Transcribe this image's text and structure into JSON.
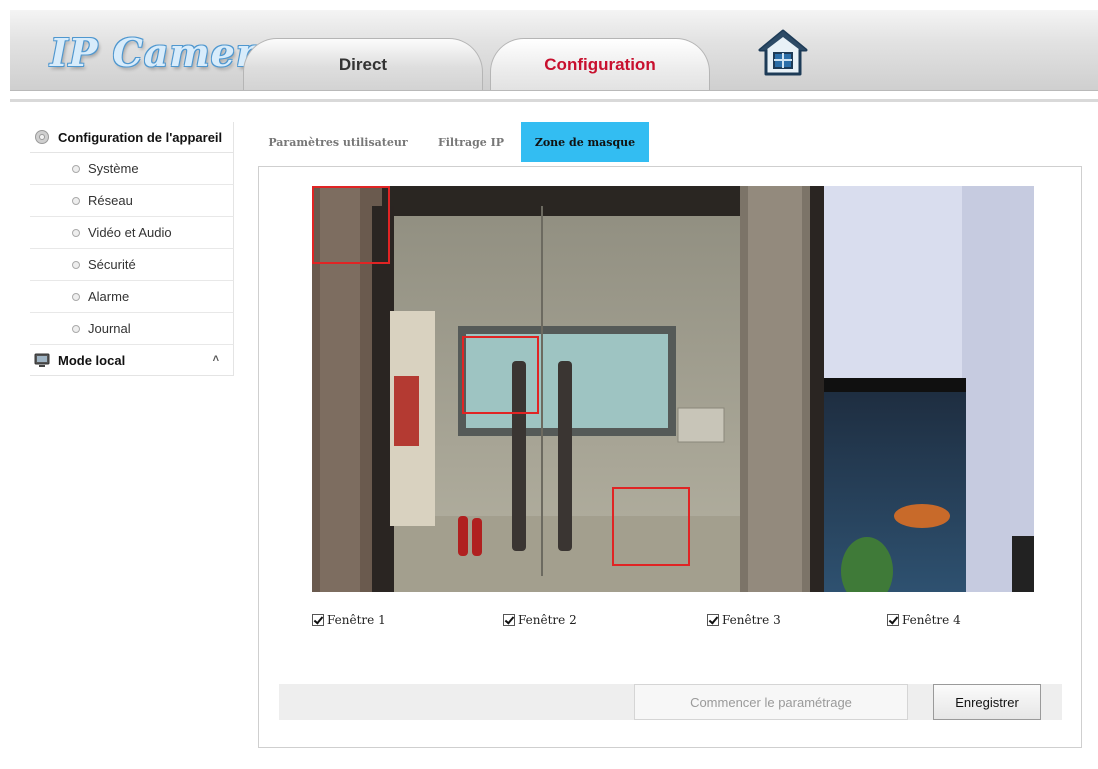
{
  "header": {
    "logo": "IP Camera",
    "tabs": [
      {
        "label": "Direct",
        "active": false
      },
      {
        "label": "Configuration",
        "active": true
      }
    ],
    "home_icon": "home-icon"
  },
  "sidebar": {
    "device_config": {
      "label": "Configuration de l'appareil",
      "icon": "gear-icon"
    },
    "items": [
      {
        "label": "Système"
      },
      {
        "label": "Réseau"
      },
      {
        "label": "Vidéo et Audio"
      },
      {
        "label": "Sécurité"
      },
      {
        "label": "Alarme"
      },
      {
        "label": "Journal"
      }
    ],
    "local_mode": {
      "label": "Mode local",
      "icon": "monitor-icon",
      "caret": "˄"
    }
  },
  "subtabs": [
    {
      "label": "Paramètres utilisateur",
      "active": false
    },
    {
      "label": "Filtrage IP",
      "active": false
    },
    {
      "label": "Zone de masque",
      "active": true
    }
  ],
  "windows": [
    {
      "label": "Fenêtre 1",
      "checked": true
    },
    {
      "label": "Fenêtre 2",
      "checked": true
    },
    {
      "label": "Fenêtre 3",
      "checked": true
    },
    {
      "label": "Fenêtre 4",
      "checked": true
    }
  ],
  "actions": {
    "start_label": "Commencer le paramétrage",
    "save_label": "Enregistrer"
  },
  "colors": {
    "active_subtab": "#33bdf2",
    "active_tab_text": "#c8102e",
    "mask_border": "#e02424",
    "logo": "#4f97cf"
  }
}
